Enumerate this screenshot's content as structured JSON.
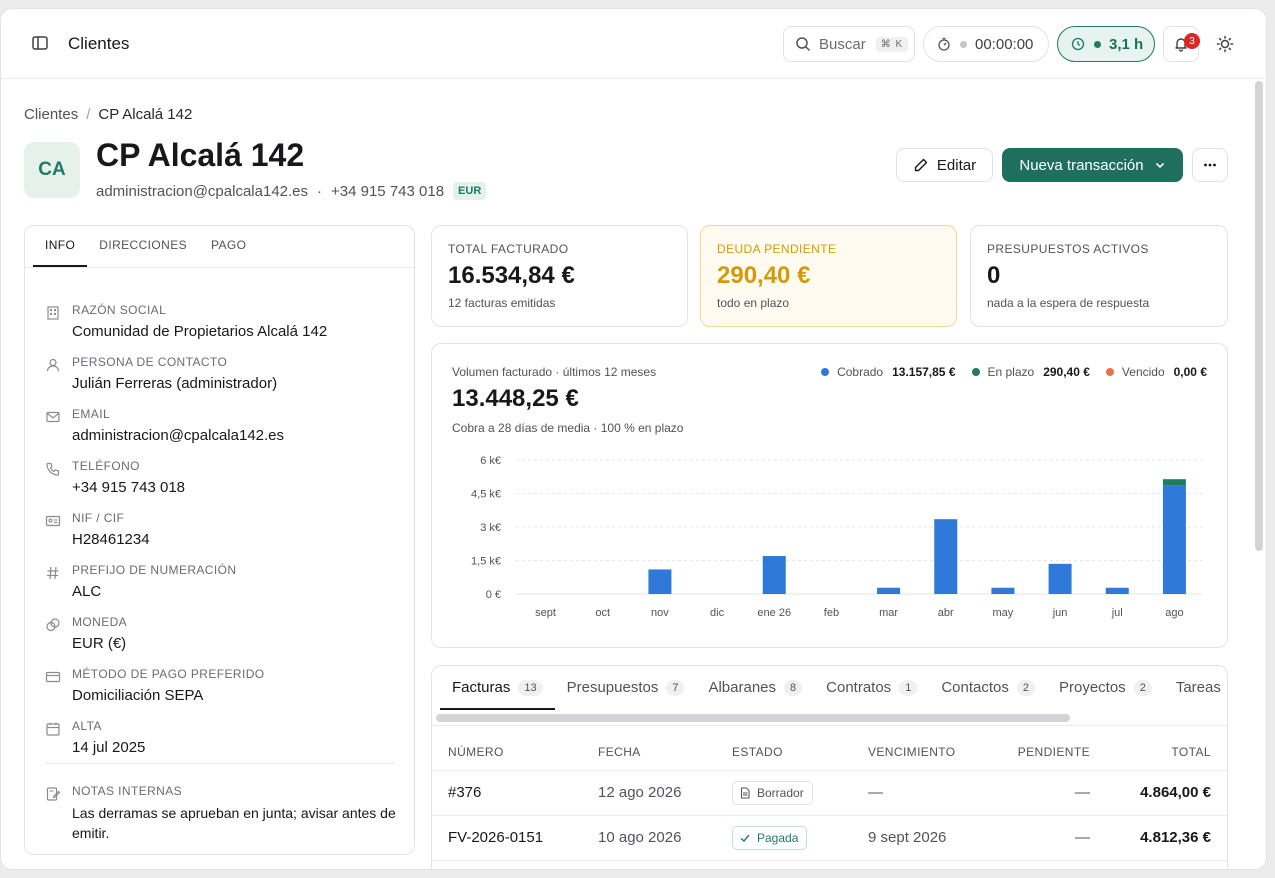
{
  "topbar": {
    "title": "Clientes",
    "search_label": "Buscar",
    "search_shortcut": "⌘ K",
    "timer": "00:00:00",
    "hours": "3,1 h",
    "notifications_count": "3"
  },
  "breadcrumb": {
    "root": "Clientes",
    "separator": "/",
    "current": "CP Alcalá 142"
  },
  "client": {
    "initials": "CA",
    "name": "CP Alcalá 142",
    "email": "administracion@cpalcala142.es",
    "dot": "·",
    "phone": "+34 915 743 018",
    "currency_tag": "EUR"
  },
  "actions": {
    "edit": "Editar",
    "new_transaction": "Nueva transacción"
  },
  "info": {
    "tabs": [
      "INFO",
      "DIRECCIONES",
      "PAGO"
    ],
    "fields": [
      {
        "icon": "building-icon",
        "label": "RAZÓN SOCIAL",
        "value": "Comunidad de Propietarios Alcalá 142"
      },
      {
        "icon": "user-icon",
        "label": "PERSONA DE CONTACTO",
        "value": "Julián Ferreras (administrador)"
      },
      {
        "icon": "mail-icon",
        "label": "EMAIL",
        "value": "administracion@cpalcala142.es"
      },
      {
        "icon": "phone-icon",
        "label": "TELÉFONO",
        "value": "+34 915 743 018"
      },
      {
        "icon": "id-card-icon",
        "label": "NIF / CIF",
        "value": "H28461234"
      },
      {
        "icon": "hash-icon",
        "label": "PREFIJO DE NUMERACIÓN",
        "value": "ALC"
      },
      {
        "icon": "coins-icon",
        "label": "MONEDA",
        "value": "EUR (€)"
      },
      {
        "icon": "credit-card-icon",
        "label": "MÉTODO DE PAGO PREFERIDO",
        "value": "Domiciliación SEPA"
      },
      {
        "icon": "calendar-icon",
        "label": "ALTA",
        "value": "14 jul 2025"
      }
    ],
    "notes_label": "NOTAS INTERNAS",
    "notes": "Las derramas se aprueban en junta; avisar antes de emitir."
  },
  "stats": [
    {
      "label": "TOTAL FACTURADO",
      "value": "16.534,84 €",
      "sub": "12 facturas emitidas"
    },
    {
      "label": "DEUDA PENDIENTE",
      "value": "290,40 €",
      "sub": "todo en plazo"
    },
    {
      "label": "PRESUPUESTOS ACTIVOS",
      "value": "0",
      "sub": "nada a la espera de respuesta"
    }
  ],
  "chart_card": {
    "subtitle": "Volumen facturado · últimos 12 meses",
    "total": "13.448,25 €",
    "caption": "Cobra a 28 días de media · 100 % en plazo",
    "legend": [
      {
        "name": "Cobrado",
        "amount": "13.157,85 €",
        "color": "#2f7ad9"
      },
      {
        "name": "En plazo",
        "amount": "290,40 €",
        "color": "#1f7a66"
      },
      {
        "name": "Vencido",
        "amount": "0,00 €",
        "color": "#e8734a"
      }
    ]
  },
  "chart_data": {
    "type": "bar",
    "categories": [
      "sept",
      "oct",
      "nov",
      "dic",
      "ene 26",
      "feb",
      "mar",
      "abr",
      "may",
      "jun",
      "jul",
      "ago"
    ],
    "series": [
      {
        "name": "Cobrado",
        "values": [
          0,
          0,
          1100,
          0,
          1700,
          0,
          280,
          3350,
          280,
          1350,
          280,
          4850
        ]
      },
      {
        "name": "En plazo",
        "values": [
          0,
          0,
          0,
          0,
          0,
          0,
          0,
          0,
          0,
          0,
          0,
          290.4
        ]
      },
      {
        "name": "Vencido",
        "values": [
          0,
          0,
          0,
          0,
          0,
          0,
          0,
          0,
          0,
          0,
          0,
          0
        ]
      }
    ],
    "yticks": [
      "0 €",
      "1,5 k€",
      "3 k€",
      "4,5 k€",
      "6 k€"
    ],
    "ylim": [
      0,
      6000
    ],
    "stacked": true,
    "grid": true
  },
  "table": {
    "tabs": [
      {
        "label": "Facturas",
        "count": "13"
      },
      {
        "label": "Presupuestos",
        "count": "7"
      },
      {
        "label": "Albaranes",
        "count": "8"
      },
      {
        "label": "Contratos",
        "count": "1"
      },
      {
        "label": "Contactos",
        "count": "2"
      },
      {
        "label": "Proyectos",
        "count": "2"
      },
      {
        "label": "Tareas",
        "count": ""
      }
    ],
    "headers": [
      "NÚMERO",
      "FECHA",
      "ESTADO",
      "VENCIMIENTO",
      "PENDIENTE",
      "TOTAL"
    ],
    "rows": [
      {
        "number": "#376",
        "date": "12 ago 2026",
        "status": "Borrador",
        "due": "—",
        "pending": "—",
        "total": "4.864,00 €"
      },
      {
        "number": "FV-2026-0151",
        "date": "10 ago 2026",
        "status": "Pagada",
        "due": "9 sept 2026",
        "pending": "—",
        "total": "4.812,36 €"
      }
    ]
  }
}
